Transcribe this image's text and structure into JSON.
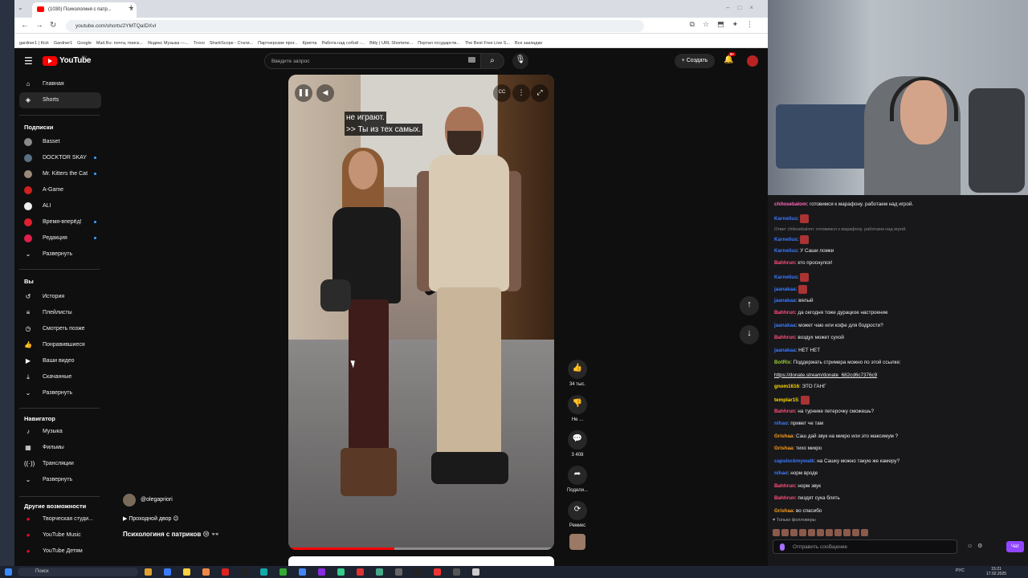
{
  "browser": {
    "tab_title": "(1030) Психологиня с патр...",
    "url": "youtube.com/shorts/2YMTQaIDXvI",
    "bookmarks": [
      "gardner1 | Kick",
      "Gardner1",
      "Google",
      "Mail.Ru: почта, поиск...",
      "Яндекс Музыка —...",
      "Trovo",
      "SharkScope - Стати...",
      "Партнерские прог...",
      "Крипта",
      "Работа над собой -...",
      "Bitly | URL Shortene...",
      "Портал государств...",
      "The Best Free Live S...",
      "Все закладки"
    ]
  },
  "youtube": {
    "brand": "YouTube",
    "region": "RU",
    "search_placeholder": "Введите запрос",
    "create_label": "Создать",
    "notifications_badge": "9+",
    "sidebar": {
      "main": [
        {
          "label": "Главная",
          "icon": "home-icon"
        },
        {
          "label": "Shorts",
          "icon": "shorts-icon"
        }
      ],
      "subs_header": "Подписки",
      "subs": [
        {
          "label": "Basset",
          "color": "#8a8a8a",
          "live": false
        },
        {
          "label": "DOCKTOR SKAY",
          "color": "#5a6f80",
          "live": true
        },
        {
          "label": "Mr. Kitters the Cat",
          "color": "#9a8a7a",
          "live": true
        },
        {
          "label": "A-Game",
          "color": "#d02020",
          "live": false
        },
        {
          "label": "ALI",
          "color": "#eeeeee",
          "live": false
        },
        {
          "label": "Время-вперёд!",
          "color": "#e02030",
          "live": true
        },
        {
          "label": "Редакция",
          "color": "#e0204a",
          "live": true
        }
      ],
      "expand": "Развернуть",
      "you_header": "Вы",
      "you": [
        {
          "label": "История",
          "icon": "history-icon"
        },
        {
          "label": "Плейлисты",
          "icon": "playlists-icon"
        },
        {
          "label": "Смотреть позже",
          "icon": "watch-later-icon"
        },
        {
          "label": "Понравившиеся",
          "icon": "liked-icon"
        },
        {
          "label": "Ваши видео",
          "icon": "your-videos-icon"
        },
        {
          "label": "Скачанные",
          "icon": "downloads-icon"
        },
        {
          "label": "Развернуть",
          "icon": "chevron-down-icon"
        }
      ],
      "nav_header": "Навигатор",
      "nav": [
        {
          "label": "Музыка",
          "icon": "music-icon"
        },
        {
          "label": "Фильмы",
          "icon": "films-icon"
        },
        {
          "label": "Трансляции",
          "icon": "live-icon"
        },
        {
          "label": "Развернуть",
          "icon": "chevron-down-icon"
        }
      ],
      "more_header": "Другие возможности",
      "more": [
        {
          "label": "Творческая студи...",
          "icon": "studio-icon"
        },
        {
          "label": "YouTube Music",
          "icon": "yt-music-icon"
        },
        {
          "label": "YouTube Детям",
          "icon": "yt-kids-icon"
        }
      ]
    },
    "short": {
      "caption_line1": "не играют.",
      "caption_line2": ">> Ты из тех самых.",
      "channel": "@olegapriori",
      "playlist": "Проходной двор 😉",
      "title": "Психологиня с патриков 😢 👓",
      "progress": 0.4
    },
    "actions": {
      "likes": "34 тыс.",
      "dislike": "Не ...",
      "comments": "3 408",
      "share": "Подели...",
      "remix": "Ремикс"
    }
  },
  "chat": {
    "messages": [
      {
        "user": "chitosebalom",
        "color": "#ff69b4",
        "text": "готовимся к марафону. работаем над игрой."
      },
      {
        "user": "Karnelius",
        "color": "#3a7bff",
        "text": "",
        "emote": true
      },
      {
        "reply": "Ответ chitosebalom: готовимся к марафону. работаем над игрой."
      },
      {
        "user": "Karnelius",
        "color": "#3a7bff",
        "text": "",
        "emote": true
      },
      {
        "user": "Karnelius",
        "color": "#3a7bff",
        "text": "У Саши ломки"
      },
      {
        "user": "Bahhrun",
        "color": "#ff4f7a",
        "text": "кто проснулся!"
      },
      {
        "user": "Karnelius",
        "color": "#3a7bff",
        "text": "",
        "emote": true
      },
      {
        "user": "jaanakaa",
        "color": "#3a7bff",
        "text": "",
        "emote": true
      },
      {
        "user": "jaanakaa",
        "color": "#3a7bff",
        "text": "вялый"
      },
      {
        "user": "Bahhrun",
        "color": "#ff4f7a",
        "text": "да сегодня тоже дурацкое настроение"
      },
      {
        "user": "jaanakaa",
        "color": "#3a7bff",
        "text": "может чаю или кофе для бодрости?"
      },
      {
        "user": "Bahhrun",
        "color": "#ff4f7a",
        "text": "воздух может сухой"
      },
      {
        "user": "jaanakaa",
        "color": "#3a7bff",
        "text": "НЕТ НЕТ"
      },
      {
        "user": "BotRix",
        "color": "#9acd32",
        "text": "Поддержать стримера можно по этой ссылке:"
      },
      {
        "link": "https://donate.stream/donate_682cd6c7376c9"
      },
      {
        "user": "gnom1616",
        "color": "#ffd700",
        "text": "ЭТО ГАНГ"
      },
      {
        "user": "templar15",
        "color": "#ffd700",
        "text": "",
        "emote": true
      },
      {
        "user": "Bahhrun",
        "color": "#ff4f7a",
        "text": "на турнике петерочку сможешь?"
      },
      {
        "user": "nihao",
        "color": "#3a7bff",
        "text": "привет че там"
      },
      {
        "user": "Grishaa",
        "color": "#ff9f1a",
        "text": "Саш дай звук на микро или это максимум ?"
      },
      {
        "user": "Grishaa",
        "color": "#ff9f1a",
        "text": "тихо микро"
      },
      {
        "user": "capslockmywalk",
        "color": "#3a7bff",
        "text": "на Сашку можно такую же камеру?"
      },
      {
        "user": "nihao",
        "color": "#3a7bff",
        "text": "норм вроде"
      },
      {
        "user": "Bahhrun",
        "color": "#ff4f7a",
        "text": "норм звук"
      },
      {
        "user": "Bahhrun",
        "color": "#ff4f7a",
        "text": "пиздят сука блять"
      },
      {
        "user": "Grishaa",
        "color": "#ff9f1a",
        "text": "во спасибо"
      }
    ],
    "followers_only": "Только фолловеры",
    "input_placeholder": "Отправить сообщение",
    "send_label": "Чат"
  },
  "taskbar": {
    "search": "Поиск",
    "lang": "РУС",
    "time": "15:21",
    "date": "17.02.2025"
  }
}
